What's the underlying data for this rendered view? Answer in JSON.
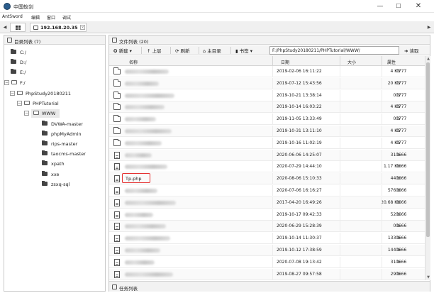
{
  "window": {
    "title": "中国蚁剑",
    "min": "—",
    "max": "☐",
    "close": "✕"
  },
  "menu": [
    "AntSword",
    "编辑",
    "窗口",
    "调试"
  ],
  "tabs": {
    "prev": "◀",
    "next": "▶",
    "site": "192.168.20.35",
    "close": "×"
  },
  "tree": {
    "title": "目录列表 (7)",
    "nodes": [
      {
        "label": "C:/",
        "toggle": ""
      },
      {
        "label": "D:/",
        "toggle": ""
      },
      {
        "label": "E:/",
        "toggle": ""
      },
      {
        "label": "F:/",
        "toggle": "−"
      },
      {
        "label": "PhpStudy20180211",
        "toggle": "−"
      },
      {
        "label": "PHPTutorial",
        "toggle": "−"
      },
      {
        "label": "WWW",
        "toggle": "−"
      },
      {
        "label": "DVWA-master",
        "toggle": ""
      },
      {
        "label": "phpMyAdmin",
        "toggle": ""
      },
      {
        "label": "rips-master",
        "toggle": ""
      },
      {
        "label": "taocms-master",
        "toggle": ""
      },
      {
        "label": "xpath",
        "toggle": ""
      },
      {
        "label": "xxe",
        "toggle": ""
      },
      {
        "label": "zsxq-sql",
        "toggle": ""
      }
    ]
  },
  "files": {
    "title": "文件列表 (20)",
    "toolbar": {
      "new": "✪ 新建 ▾",
      "up": "↑ 上层",
      "refresh": "⟳ 刷新",
      "home": "⌂ 主目录",
      "bookmark": "▮ 书签 ▾",
      "path": "F:/PhpStudy20180211/PHPTutorial/WWW/",
      "read": "➜ 读取"
    },
    "columns": {
      "name": "名称",
      "date": "日期",
      "size": "大小",
      "perm": "属性"
    },
    "rows": [
      {
        "type": "folder",
        "name": "",
        "date": "2019-02-06 16:11:22",
        "size": "4 Kb",
        "perm": "0777"
      },
      {
        "type": "folder",
        "name": "",
        "date": "2019-07-12 15:43:56",
        "size": "20 Kb",
        "perm": "0777"
      },
      {
        "type": "folder",
        "name": "",
        "date": "2019-10-21 13:38:14",
        "size": "0 b",
        "perm": "0777"
      },
      {
        "type": "folder",
        "name": "",
        "date": "2019-10-14 16:03:22",
        "size": "4 Kb",
        "perm": "0777"
      },
      {
        "type": "folder",
        "name": "",
        "date": "2019-11-05 13:33:49",
        "size": "0 b",
        "perm": "0777"
      },
      {
        "type": "folder",
        "name": "",
        "date": "2019-10-31 13:11:10",
        "size": "4 Kb",
        "perm": "0777"
      },
      {
        "type": "folder",
        "name": "",
        "date": "2019-10-16 11:02:19",
        "size": "4 Kb",
        "perm": "0777"
      },
      {
        "type": "file",
        "name": "",
        "date": "2020-06-06 14:25:07",
        "size": "31 b",
        "perm": "0666"
      },
      {
        "type": "file",
        "name": "",
        "date": "2020-07-29 14:44:10",
        "size": "1.17 Kb",
        "perm": "0666"
      },
      {
        "type": "file",
        "name": "Tp.php",
        "date": "2020-08-06 15:10:33",
        "size": "44 b",
        "perm": "0666"
      },
      {
        "type": "file",
        "name": "",
        "date": "2020-07-06 16:16:27",
        "size": "576 b",
        "perm": "0666"
      },
      {
        "type": "file",
        "name": "",
        "date": "2017-04-20 16:49:26",
        "size": "20.68 Kb",
        "perm": "0666"
      },
      {
        "type": "file",
        "name": "",
        "date": "2019-10-17 09:42:33",
        "size": "52 b",
        "perm": "0666"
      },
      {
        "type": "file",
        "name": "",
        "date": "2020-06-29 15:28:39",
        "size": "0 b",
        "perm": "0666"
      },
      {
        "type": "file",
        "name": "",
        "date": "2019-10-14 11:30:37",
        "size": "133 b",
        "perm": "0666"
      },
      {
        "type": "file",
        "name": "",
        "date": "2019-10-12 17:38:59",
        "size": "144 b",
        "perm": "0666"
      },
      {
        "type": "file",
        "name": "",
        "date": "2020-07-08 19:13:42",
        "size": "31 b",
        "perm": "0666"
      },
      {
        "type": "file",
        "name": "",
        "date": "2019-08-27 09:57:58",
        "size": "29 b",
        "perm": "0666"
      }
    ],
    "scroll_up": "▲",
    "scroll_down": "▼"
  },
  "tasks": {
    "title": "任务列表"
  },
  "colors": {
    "highlight_box": "#e53030",
    "folder_dark": "#444444",
    "scroll_thumb": "#c1c1c1"
  }
}
